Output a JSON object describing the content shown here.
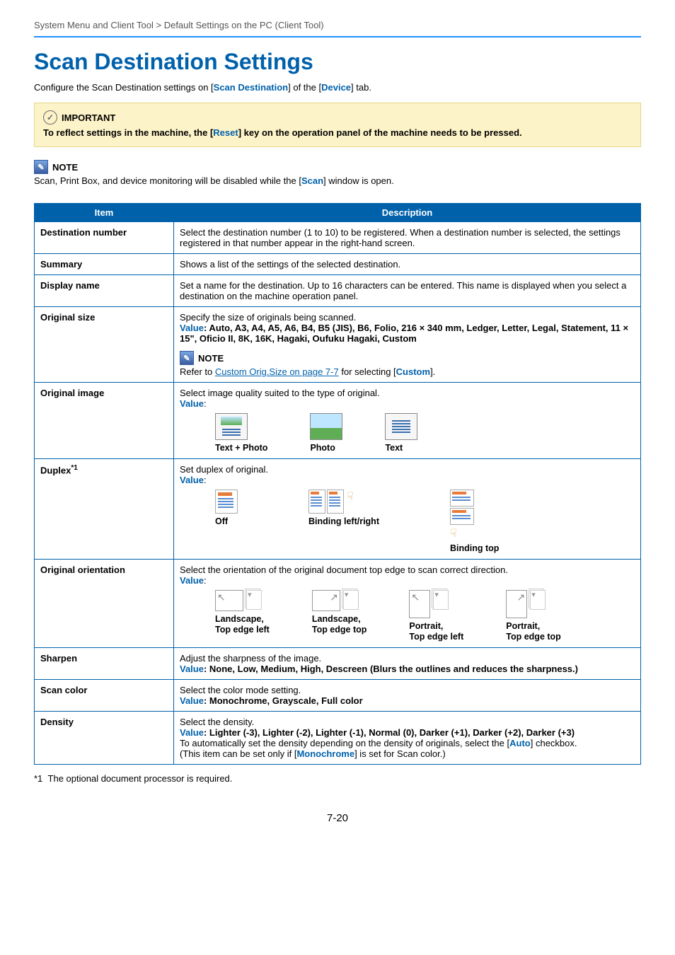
{
  "breadcrumb": {
    "left": "System Menu and Client Tool",
    "sep": ">",
    "right": "Default Settings on the PC (Client Tool)"
  },
  "title": "Scan Destination Settings",
  "intro": {
    "pre": "Configure the Scan Destination settings on [",
    "link1": "Scan Destination",
    "mid": "] of the [",
    "link2": "Device",
    "post": "] tab."
  },
  "important": {
    "label": "IMPORTANT",
    "pre": "To reflect settings in the machine, the [",
    "link": "Reset",
    "post": "] key on the operation panel of the machine needs to be pressed."
  },
  "note_top": {
    "label": "NOTE",
    "pre": "Scan, Print Box, and device monitoring will be disabled while the [",
    "link": "Scan",
    "post": "] window is open."
  },
  "table": {
    "head_item": "Item",
    "head_desc": "Description",
    "rows": {
      "dest_num": {
        "item": "Destination number",
        "desc": "Select the destination number (1 to 10) to be registered. When a destination number is selected, the settings registered in that number appear in the right-hand screen."
      },
      "summary": {
        "item": "Summary",
        "desc": "Shows a list of the settings of the selected destination."
      },
      "display_name": {
        "item": "Display name",
        "desc": "Set a name for the destination. Up to 16 characters can be entered. This name is displayed when you select a destination on the machine operation panel."
      },
      "original_size": {
        "item": "Original size",
        "desc": "Specify the size of originals being scanned.",
        "value_label": "Value",
        "value": ": Auto, A3, A4, A5, A6, B4, B5 (JIS), B6, Folio, 216 × 340 mm, Ledger, Letter, Legal, Statement, 11 × 15\", Oficio II, 8K, 16K, Hagaki, Oufuku Hagaki, Custom",
        "note_label": "NOTE",
        "note_pre": "Refer to ",
        "note_link": "Custom Orig.Size on page 7-7",
        "note_mid": " for selecting [",
        "note_link2": "Custom",
        "note_post": "]."
      },
      "original_image": {
        "item": "Original image",
        "desc": "Select image quality suited to the type of original.",
        "value_label": "Value",
        "opts": [
          "Text + Photo",
          "Photo",
          "Text"
        ]
      },
      "duplex": {
        "item_main": "Duplex",
        "item_sup": "*1",
        "desc": "Set duplex of original.",
        "value_label": "Value",
        "opts": [
          "Off",
          "Binding left/right",
          "Binding top"
        ]
      },
      "orientation": {
        "item": "Original orientation",
        "desc": "Select the orientation of the original document top edge to scan correct direction.",
        "value_label": "Value",
        "opts": [
          "Landscape,\nTop edge left",
          "Landscape,\nTop edge top",
          "Portrait,\nTop edge left",
          "Portrait,\nTop edge top"
        ]
      },
      "sharpen": {
        "item": "Sharpen",
        "desc": "Adjust the sharpness of the image.",
        "value_label": "Value",
        "value": ": None, Low, Medium, High, Descreen (Blurs the outlines and reduces the sharpness.)"
      },
      "scan_color": {
        "item": "Scan color",
        "desc": "Select the color mode setting.",
        "value_label": "Value",
        "value": ": Monochrome, Grayscale, Full color"
      },
      "density": {
        "item": "Density",
        "desc": "Select the density.",
        "value_label": "Value",
        "value": ": Lighter (-3), Lighter (-2), Lighter (-1), Normal (0), Darker (+1), Darker (+2), Darker (+3)",
        "line3_pre": "To automatically set the density depending on the density of originals, select the [",
        "line3_link": "Auto",
        "line3_post": "] checkbox.",
        "line4_pre": "(This item can be set only if [",
        "line4_link": "Monochrome",
        "line4_post": "] is set for Scan color.)"
      }
    }
  },
  "footnote": {
    "marker": "*1",
    "text": "The optional document processor is required."
  },
  "page_number": "7-20"
}
